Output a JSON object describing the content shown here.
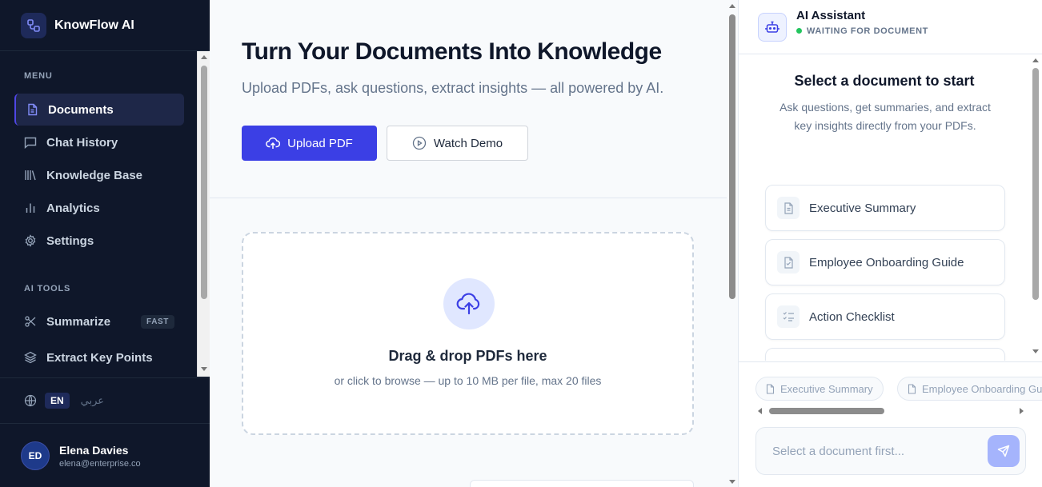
{
  "brand": {
    "name": "KnowFlow AI",
    "logo_icon": "workflow-icon"
  },
  "sidebar": {
    "menu_label": "MENU",
    "menu_items": [
      {
        "label": "Documents",
        "icon": "document-icon",
        "active": true
      },
      {
        "label": "Chat History",
        "icon": "chat-icon",
        "active": false
      },
      {
        "label": "Knowledge Base",
        "icon": "library-icon",
        "active": false
      },
      {
        "label": "Analytics",
        "icon": "bar-chart-icon",
        "active": false
      },
      {
        "label": "Settings",
        "icon": "gear-icon",
        "active": false
      }
    ],
    "tools_label": "AI TOOLS",
    "tool_items": [
      {
        "label": "Summarize",
        "icon": "scissors-icon",
        "badge": "FAST"
      },
      {
        "label": "Extract Key Points",
        "icon": "layers-icon"
      }
    ],
    "language": {
      "active": "EN",
      "alternate": "عربي",
      "icon": "globe-icon"
    },
    "user": {
      "initials": "ED",
      "name": "Elena Davies",
      "email": "elena@enterprise.co"
    }
  },
  "hero": {
    "title": "Turn Your Documents Into Knowledge",
    "subtitle": "Upload PDFs, ask questions, extract insights — all powered by AI.",
    "upload_button": "Upload PDF",
    "demo_button": "Watch Demo"
  },
  "dropzone": {
    "title": "Drag & drop PDFs here",
    "subtitle": "or click to browse — up to 10 MB per file, max 20 files"
  },
  "assistant": {
    "title": "AI Assistant",
    "status": "WAITING FOR DOCUMENT",
    "status_color": "#22c55e",
    "empty_title": "Select a document to start",
    "empty_subtitle": "Ask questions, get summaries, and extract key insights directly from your PDFs.",
    "suggestions": [
      {
        "label": "Executive Summary",
        "icon": "document-icon"
      },
      {
        "label": "Employee Onboarding Guide",
        "icon": "file-icon"
      },
      {
        "label": "Action Checklist",
        "icon": "checklist-icon"
      }
    ],
    "chips": [
      "Executive Summary",
      "Employee Onboarding Guide"
    ],
    "input_placeholder": "Select a document first..."
  },
  "colors": {
    "accent": "#3b3fe5",
    "sidebar_bg": "#0f172a"
  }
}
